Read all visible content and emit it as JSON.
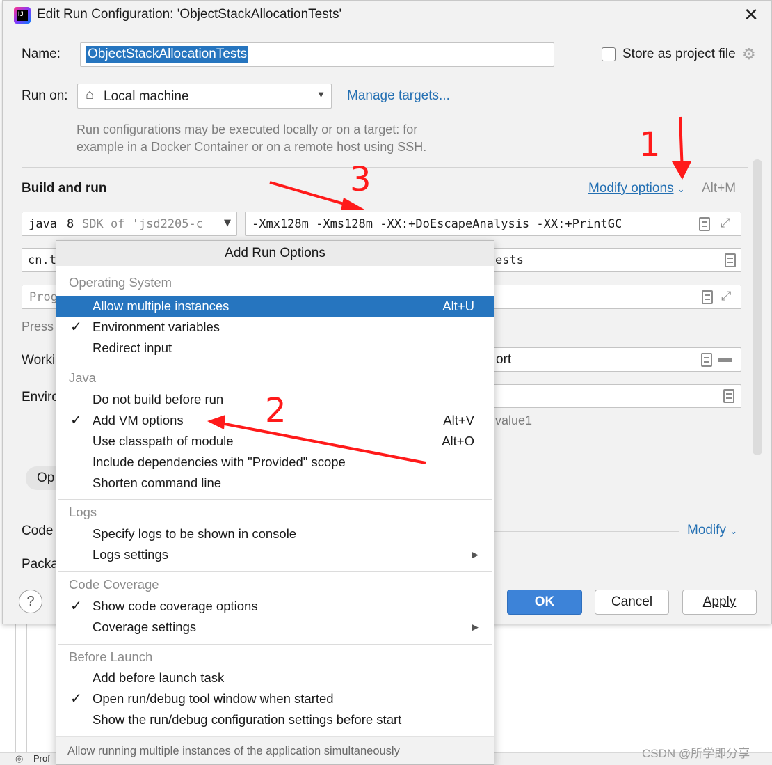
{
  "dialog": {
    "title": "Edit Run Configuration: 'ObjectStackAllocationTests'",
    "name_label": "Name:",
    "name_value": "ObjectStackAllocationTests",
    "store_label": "Store as project file",
    "run_on_label": "Run on:",
    "run_on_value": "Local machine",
    "manage_targets": "Manage targets...",
    "hint_line1": "Run configurations may be executed locally or on a target: for",
    "hint_line2": "example in a Docker Container or on a remote host using SSH.",
    "build_run": "Build and run",
    "modify_options": "Modify options",
    "modify_shortcut": "Alt+M",
    "sdk_java": "java",
    "sdk_ver": "8",
    "sdk_rest": "SDK of 'jsd2205-c",
    "vm_options": "-Xmx128m -Xms128m -XX:+DoEscapeAnalysis -XX:+PrintGC",
    "main_class_prefix": "cn.t",
    "main_class_suffix": "ests",
    "program_args_placeholder": "Prog",
    "press_prefix": "Press",
    "working_dir_label": "Worki",
    "working_dir_suffix": "ort",
    "env_label": "Enviro",
    "env_hint_suffix": "value1",
    "open_pill": "Op",
    "code_label": "Code",
    "package_label": "Packa",
    "modify_link": "Modify",
    "ok": "OK",
    "cancel": "Cancel",
    "apply": "Apply",
    "help": "?"
  },
  "popup": {
    "title": "Add Run Options",
    "sections": [
      {
        "label": "Operating System",
        "items": [
          {
            "label": "Allow multiple instances",
            "shortcut": "Alt+U",
            "checked": false,
            "selected": true
          },
          {
            "label": "Environment variables",
            "shortcut": "",
            "checked": true
          },
          {
            "label": "Redirect input",
            "shortcut": "",
            "checked": false
          }
        ]
      },
      {
        "label": "Java",
        "items": [
          {
            "label": "Do not build before run",
            "shortcut": "",
            "checked": false
          },
          {
            "label": "Add VM options",
            "shortcut": "Alt+V",
            "checked": true
          },
          {
            "label": "Use classpath of module",
            "shortcut": "Alt+O",
            "checked": false
          },
          {
            "label": "Include dependencies with \"Provided\" scope",
            "shortcut": "",
            "checked": false
          },
          {
            "label": "Shorten command line",
            "shortcut": "",
            "checked": false
          }
        ]
      },
      {
        "label": "Logs",
        "items": [
          {
            "label": "Specify logs to be shown in console",
            "shortcut": "",
            "checked": false
          },
          {
            "label": "Logs settings",
            "shortcut": "",
            "checked": false,
            "submenu": true
          }
        ]
      },
      {
        "label": "Code Coverage",
        "items": [
          {
            "label": "Show code coverage options",
            "shortcut": "",
            "checked": true
          },
          {
            "label": "Coverage settings",
            "shortcut": "",
            "checked": false,
            "submenu": true
          }
        ]
      },
      {
        "label": "Before Launch",
        "items": [
          {
            "label": "Add before launch task",
            "shortcut": "",
            "checked": false
          },
          {
            "label": "Open run/debug tool window when started",
            "shortcut": "",
            "checked": true
          },
          {
            "label": "Show the run/debug configuration settings before start",
            "shortcut": "",
            "checked": false
          }
        ]
      }
    ],
    "footer": "Allow running multiple instances of the application simultaneously",
    "check_glyph": "✓",
    "submenu_glyph": "▶"
  },
  "annotations": {
    "n1": "1",
    "n2": "2",
    "n3": "3",
    "color": "#ff1a1a"
  },
  "background": {
    "bottom_fragment": "Prof"
  },
  "watermark": "CSDN @所学即分享",
  "colors": {
    "selection": "#2675bf",
    "link": "#2470b3",
    "primary_button": "#3d83d8"
  }
}
